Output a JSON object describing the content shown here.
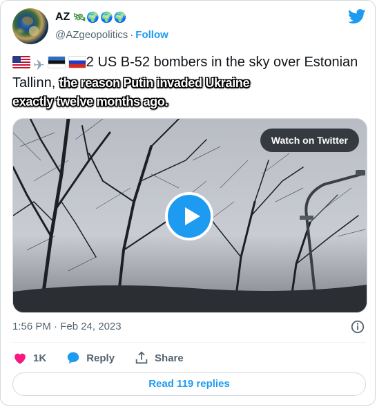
{
  "author": {
    "name": "AZ",
    "name_emoji": "🛰🌍🌍🌍",
    "handle": "@AZgeopolitics",
    "separator": "·",
    "follow_label": "Follow"
  },
  "tweet": {
    "text_main": "2 US B-52 bombers in the sky over Estonian Tallinn,",
    "flag_emojis": [
      "us-flag-icon",
      "airplane-icon",
      "estonia-flag-icon",
      "russia-flag-icon"
    ],
    "overlay_caption_line1": "the reason Putin invaded Ukraine",
    "overlay_caption_line2": "exactly twelve months ago."
  },
  "media": {
    "watch_label": "Watch on Twitter"
  },
  "meta": {
    "timestamp": "1:56 PM · Feb 24, 2023"
  },
  "actions": {
    "like_count": "1K",
    "reply_label": "Reply",
    "share_label": "Share"
  },
  "footer": {
    "read_replies_label": "Read 119 replies"
  },
  "colors": {
    "accent": "#1d9bf0",
    "like": "#f91880",
    "secondary_text": "#536471",
    "border": "#cfd9de"
  }
}
